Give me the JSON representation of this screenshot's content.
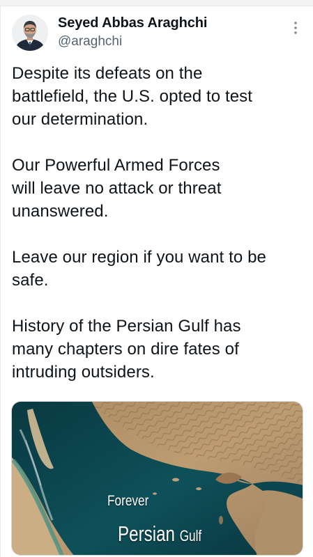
{
  "author": {
    "display_name": "Seyed Abbas Araghchi",
    "handle": "@araghchi",
    "avatar_icon": "profile-photo-avatar"
  },
  "menu": {
    "icon": "more-vertical-icon"
  },
  "tweet": {
    "paragraphs": [
      "Despite its defeats on the\nbattlefield, the U.S. opted to test\nour determination.",
      "Our Powerful Armed Forces\nwill leave no attack or threat\nunanswered.",
      "Leave our region if you want to be\nsafe.",
      "History of the Persian Gulf has\nmany chapters on dire fates of\nintruding outsiders."
    ]
  },
  "media": {
    "caption_line1": "Forever",
    "caption_line2_main": "Persian",
    "caption_line2_small": "Gulf"
  },
  "colors": {
    "text_primary": "#0f1419",
    "text_secondary": "#536471",
    "gulf_water": "#0e4f57",
    "land": "#c7a274"
  }
}
